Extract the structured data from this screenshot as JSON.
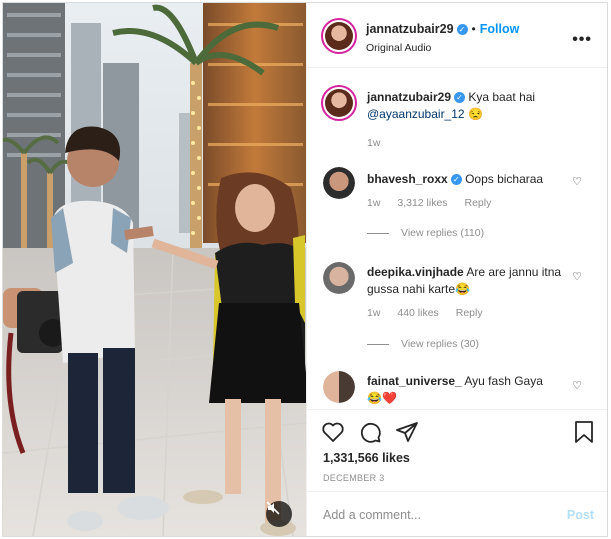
{
  "post": {
    "author": "jannatzubair29",
    "follow_label": "Follow",
    "audio": "Original Audio",
    "more_label": "•••"
  },
  "caption": {
    "username": "jannatzubair29",
    "text": "Kya baat hai",
    "mention": "@ayaanzubair_12",
    "emoji": "😒",
    "time": "1w"
  },
  "comments": [
    {
      "username": "bhavesh_roxx",
      "verified": true,
      "text": "Oops bicharaa",
      "time": "1w",
      "likes": "3,312 likes",
      "reply_label": "Reply",
      "view_replies": "View replies (110)"
    },
    {
      "username": "deepika.vinjhade",
      "verified": false,
      "text": "Are are jannu itna gussa nahi karte😂",
      "time": "1w",
      "likes": "440 likes",
      "reply_label": "Reply",
      "view_replies": "View replies (30)"
    },
    {
      "username": "fainat_universe_",
      "verified": false,
      "text": "Ayu fash Gaya",
      "emoji_line": "😂❤️"
    }
  ],
  "stats": {
    "likes": "1,331,566 likes",
    "date": "DECEMBER 3"
  },
  "composer": {
    "placeholder": "Add a comment...",
    "post_label": "Post"
  },
  "icons": {
    "like": "heart-icon",
    "comment": "comment-icon",
    "share": "paper-plane-icon",
    "save": "bookmark-icon",
    "mute": "speaker-muted-icon",
    "more": "more-options-icon"
  },
  "colors": {
    "accent": "#0095f6",
    "verified": "#3897f0",
    "muted_text": "#8e8e8e",
    "post_disabled": "#b2dffc"
  }
}
